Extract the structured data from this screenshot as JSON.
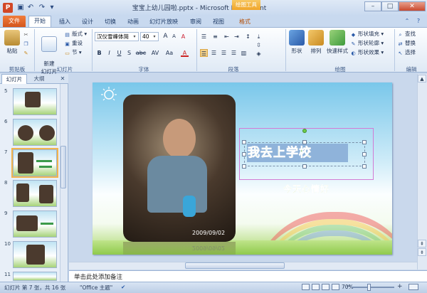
{
  "window": {
    "title": "宝宝上幼儿园啦.pptx - Microsoft PowerPoint",
    "context_tab_group": "绘图工具",
    "app_letter": "P"
  },
  "qat": {
    "save_icon": "save-icon",
    "undo_icon": "undo-icon",
    "redo_icon": "redo-icon"
  },
  "tabs": {
    "file": "文件",
    "items": [
      "开始",
      "插入",
      "设计",
      "切换",
      "动画",
      "幻灯片放映",
      "审阅",
      "视图",
      "格式"
    ]
  },
  "ribbon": {
    "clipboard": {
      "label": "剪贴板",
      "paste": "粘贴"
    },
    "slides": {
      "label": "幻灯片",
      "new_slide": "新建\n幻灯片",
      "layout": "版式",
      "reset": "重设",
      "section": "节"
    },
    "font": {
      "label": "字体",
      "font_name": "汉仪雪峰体简",
      "font_size": "40",
      "bold": "B",
      "italic": "I",
      "underline": "U",
      "strike": "S",
      "shadow": "abc",
      "spacing": "AV",
      "case": "Aa",
      "color": "A",
      "grow": "A",
      "shrink": "A",
      "clear": "A"
    },
    "paragraph": {
      "label": "段落"
    },
    "drawing": {
      "label": "绘图",
      "shapes": "形状",
      "arrange": "排列",
      "quick_styles": "快速样式",
      "shape_fill": "形状填充",
      "shape_outline": "形状轮廓",
      "shape_effects": "形状效果"
    },
    "editing": {
      "label": "编辑",
      "find": "查找",
      "replace": "替换",
      "select": "选择"
    }
  },
  "pane": {
    "tab_slides": "幻灯片",
    "tab_outline": "大纲",
    "close": "✕",
    "thumbnails": [
      {
        "num": "5"
      },
      {
        "num": "6"
      },
      {
        "num": "7"
      },
      {
        "num": "8"
      },
      {
        "num": "9"
      },
      {
        "num": "10"
      },
      {
        "num": "11"
      }
    ]
  },
  "slide": {
    "title": "我去上学校",
    "subtitle": "今天心情好",
    "photo_date": "2009/09/02"
  },
  "notes": {
    "placeholder": "单击此处添加备注"
  },
  "status": {
    "slide_info": "幻灯片 第 7 张，共 16 张",
    "theme": "\"Office 主题\"",
    "zoom": "70%",
    "zoom_minus": "−",
    "zoom_plus": "+"
  }
}
